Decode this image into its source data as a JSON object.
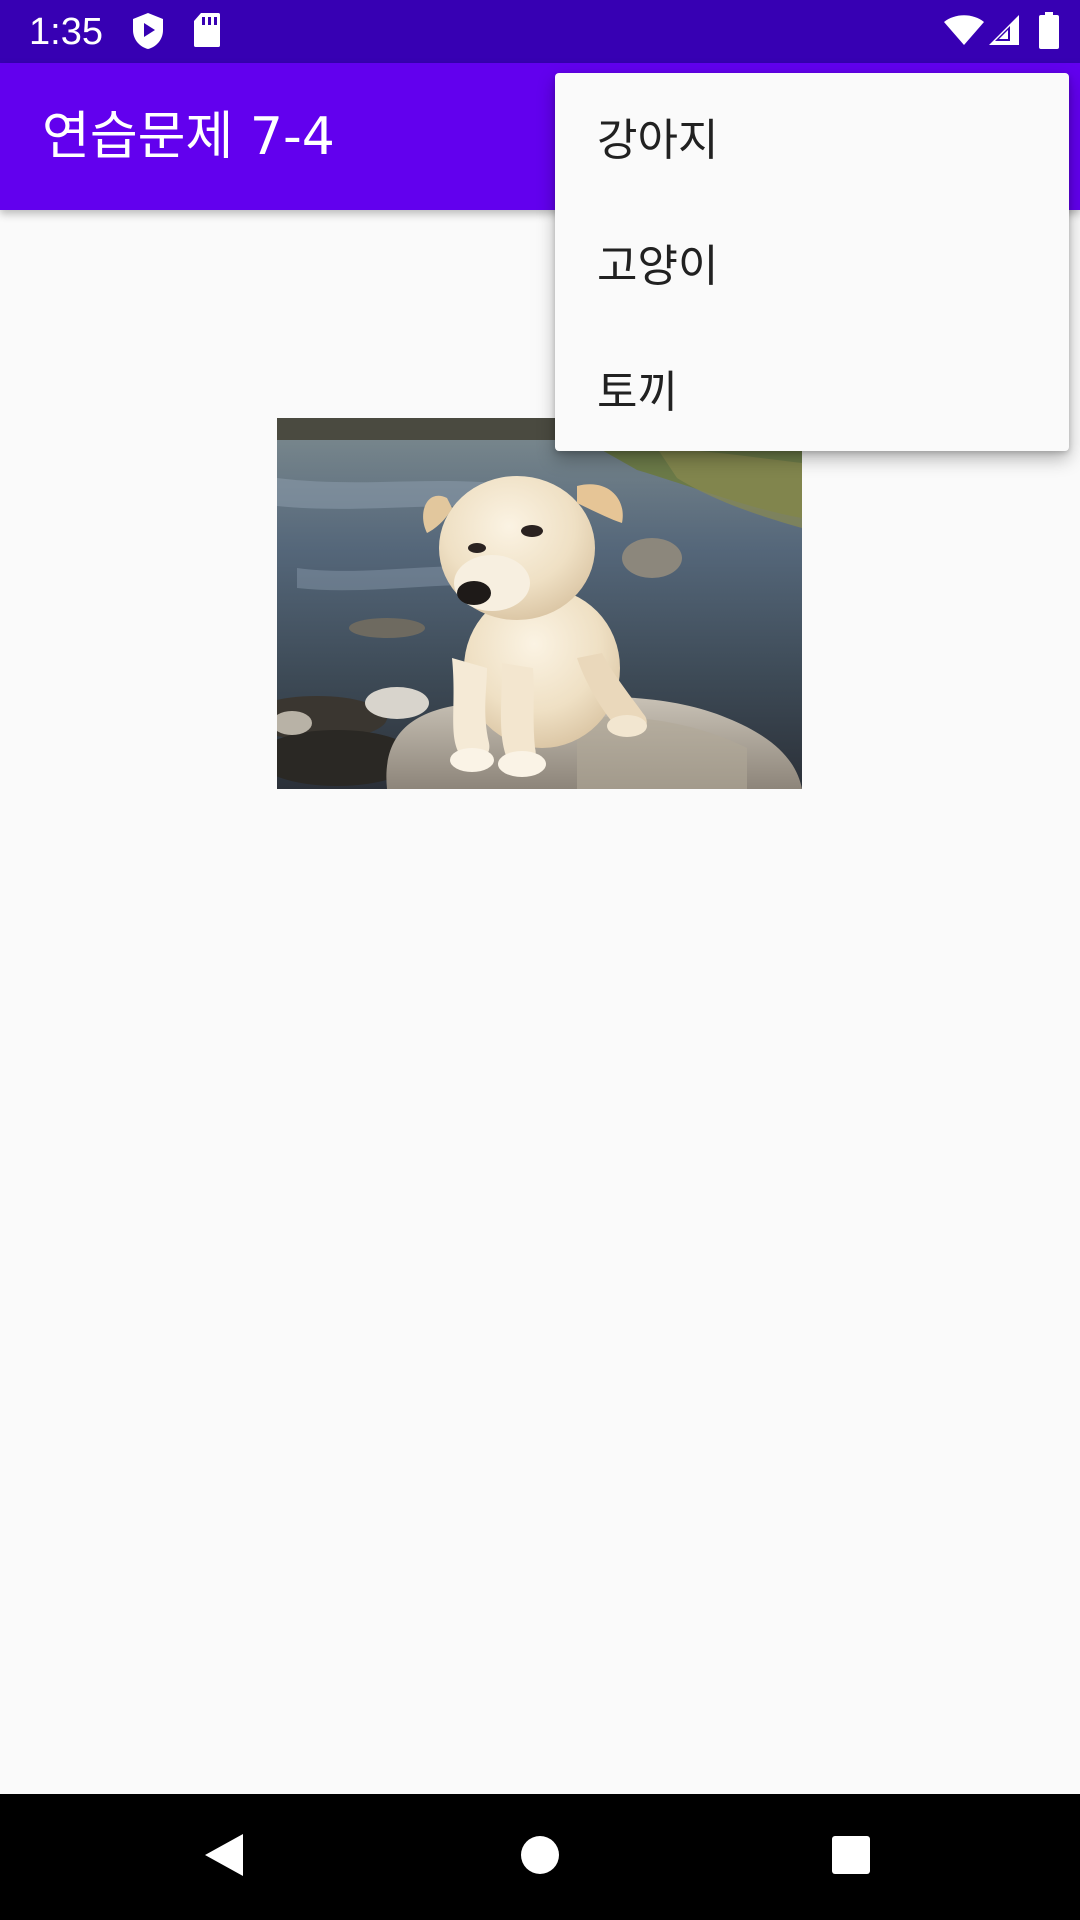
{
  "status_bar": {
    "time": "1:35",
    "icons": [
      "shield-icon",
      "sd-card-icon",
      "wifi-icon",
      "signal-icon",
      "battery-icon"
    ]
  },
  "app_bar": {
    "title": "연습문제 7-4"
  },
  "content": {
    "image": "puppy-photo"
  },
  "popup_menu": {
    "items": [
      {
        "label": "강아지"
      },
      {
        "label": "고양이"
      },
      {
        "label": "토끼"
      }
    ]
  },
  "nav_bar": {
    "buttons": [
      "back-icon",
      "home-icon",
      "recents-icon"
    ]
  },
  "colors": {
    "status_bar": "#3700b3",
    "app_bar": "#6200ee",
    "background": "#fafafa"
  }
}
